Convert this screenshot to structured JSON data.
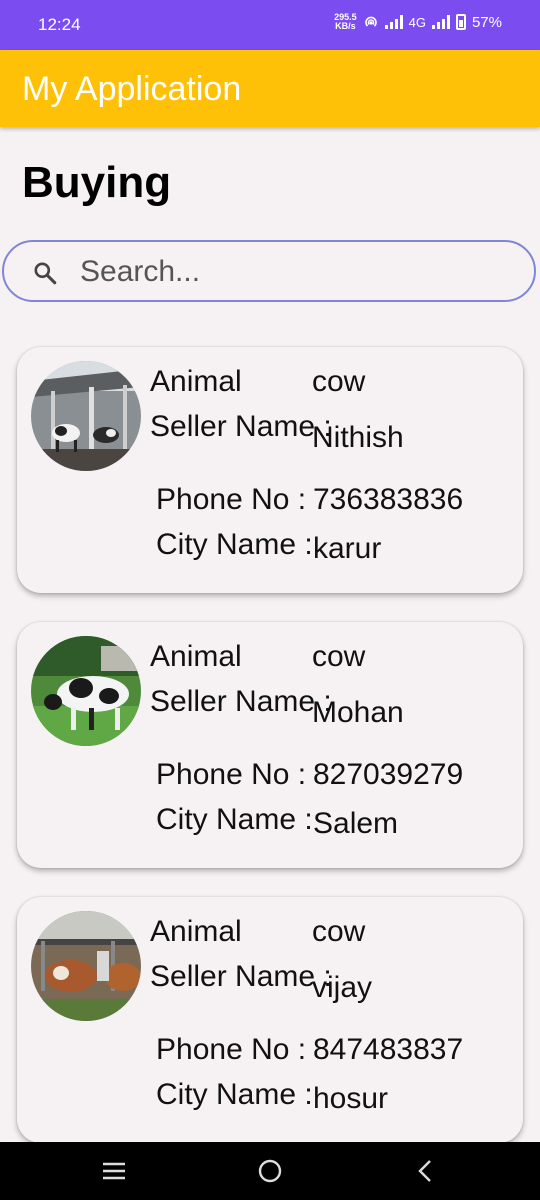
{
  "status_bar": {
    "time": "12:24",
    "speed_value": "295.5",
    "speed_unit": "KB/s",
    "network": "4G",
    "battery": "57%"
  },
  "app_bar": {
    "title": "My Application",
    "color": "#ffc107"
  },
  "page": {
    "title": "Buying"
  },
  "search": {
    "placeholder": "Search...",
    "value": ""
  },
  "listings": [
    {
      "animal_label": "Animal",
      "animal_value": "cow",
      "seller_label": "Seller Name :",
      "seller_value": "Nithish",
      "phone_label": "Phone No :",
      "phone_value": "736383836",
      "city_label": "City Name :",
      "city_value": "karur",
      "image_icon": "cattle-shed-photo"
    },
    {
      "animal_label": "Animal",
      "animal_value": "cow",
      "seller_label": "Seller Name :",
      "seller_value": "Mohan",
      "phone_label": "Phone No :",
      "phone_value": "827039279",
      "city_label": "City Name :",
      "city_value": "Salem",
      "image_icon": "holstein-cow-photo"
    },
    {
      "animal_label": "Animal",
      "animal_value": "cow",
      "seller_label": "Seller Name :",
      "seller_value": "vijay",
      "phone_label": "Phone No :",
      "phone_value": "847483837",
      "city_label": "City Name :",
      "city_value": "hosur",
      "image_icon": "brown-cows-photo"
    }
  ],
  "colors": {
    "status_bar": "#7b4df0",
    "search_border": "#7f86d6",
    "background": "#f6f2f4"
  }
}
